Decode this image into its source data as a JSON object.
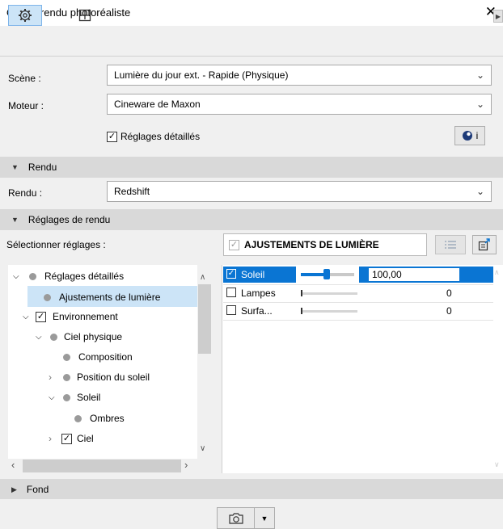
{
  "window": {
    "title": "Option rendu photoréaliste",
    "close_glyph": "✕"
  },
  "toolbar": {
    "settings_icon": "gear-icon",
    "layout_icon": "frame-icon",
    "right_glyph": "▶"
  },
  "fields": {
    "scene_label": "Scène :",
    "scene_value": "Lumière du jour ext. - Rapide (Physique)",
    "engine_label": "Moteur :",
    "engine_value": "Cineware de Maxon",
    "detailed_label": "Réglages détaillés",
    "info_glyph": "i"
  },
  "sections": {
    "rendu": "Rendu",
    "rendu_label": "Rendu :",
    "rendu_value": "Redshift",
    "render_settings": "Réglages de rendu",
    "select_settings": "Sélectionner réglages :",
    "adjustments_header": "AJUSTEMENTS DE LUMIÈRE",
    "fond": "Fond"
  },
  "tree": [
    {
      "label": "Réglages détaillés",
      "prefix": "⌄ ●"
    },
    {
      "label": "Ajustements de lumière",
      "prefix": "●"
    },
    {
      "label": "Environnement",
      "prefix": "⌄ ☑"
    },
    {
      "label": "Ciel physique",
      "prefix": "⌄ ●"
    },
    {
      "label": "Composition",
      "prefix": "●"
    },
    {
      "label": "Position du soleil",
      "prefix": "› ●"
    },
    {
      "label": "Soleil",
      "prefix": "⌄ ●"
    },
    {
      "label": "Ombres",
      "prefix": "●"
    },
    {
      "label": "Ciel",
      "prefix": "› ☑"
    }
  ],
  "lights": [
    {
      "name": "Soleil",
      "checked": true,
      "value": "100,00",
      "level": 0.5
    },
    {
      "name": "Lampes",
      "checked": false,
      "value": "0",
      "level": 0
    },
    {
      "name": "Surfa...",
      "checked": false,
      "value": "0",
      "level": 0
    }
  ],
  "colors": {
    "accent": "#0a75d3",
    "selection": "#cce4f7"
  }
}
